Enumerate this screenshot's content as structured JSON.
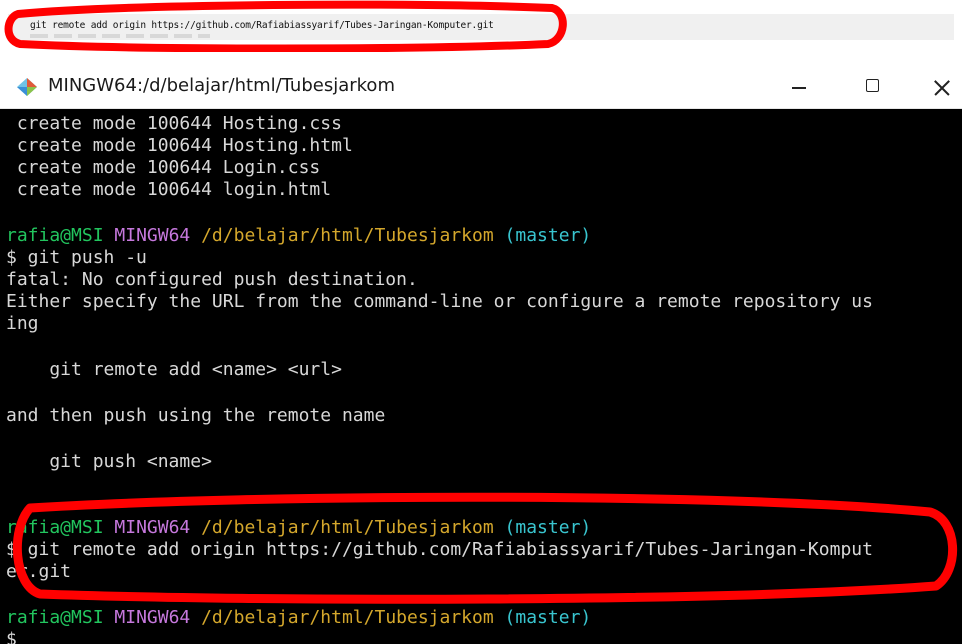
{
  "snippet": {
    "command": "git remote add origin https://github.com/Rafiabiassyarif/Tubes-Jaringan-Komputer.git"
  },
  "window": {
    "title": "MINGW64:/d/belajar/html/Tubesjarkom",
    "icon": "git-bash-diamond-icon",
    "controls": {
      "minimize": "minimize-icon",
      "maximize": "maximize-icon",
      "close": "close-icon"
    }
  },
  "terminal": {
    "create_lines": [
      " create mode 100644 Hosting.css",
      " create mode 100644 Hosting.html",
      " create mode 100644 Login.css",
      " create mode 100644 login.html"
    ],
    "prompt": {
      "user": "rafia@MSI",
      "system": "MINGW64",
      "path": "/d/belajar/html/Tubesjarkom",
      "branch": "(master)",
      "symbol": "$"
    },
    "cmd1": "$ git push -u",
    "fatal": "fatal: No configured push destination.",
    "either_1": "Either specify the URL from the command-line or configure a remote repository us",
    "either_2": "ing",
    "remote_hint": "    git remote add <name> <url>",
    "and_then": "and then push using the remote name",
    "push_hint": "    git push <name>",
    "cmd2_1": "$ git remote add origin https://github.com/Rafiabiassyarif/Tubes-Jaringan-Komput",
    "cmd2_2": "er.git",
    "cmd3": "$"
  },
  "colors": {
    "user": "#22c55e",
    "system": "#c678dd",
    "path": "#d4a72c",
    "branch": "#39c5cf",
    "annotation": "#ff0000"
  }
}
